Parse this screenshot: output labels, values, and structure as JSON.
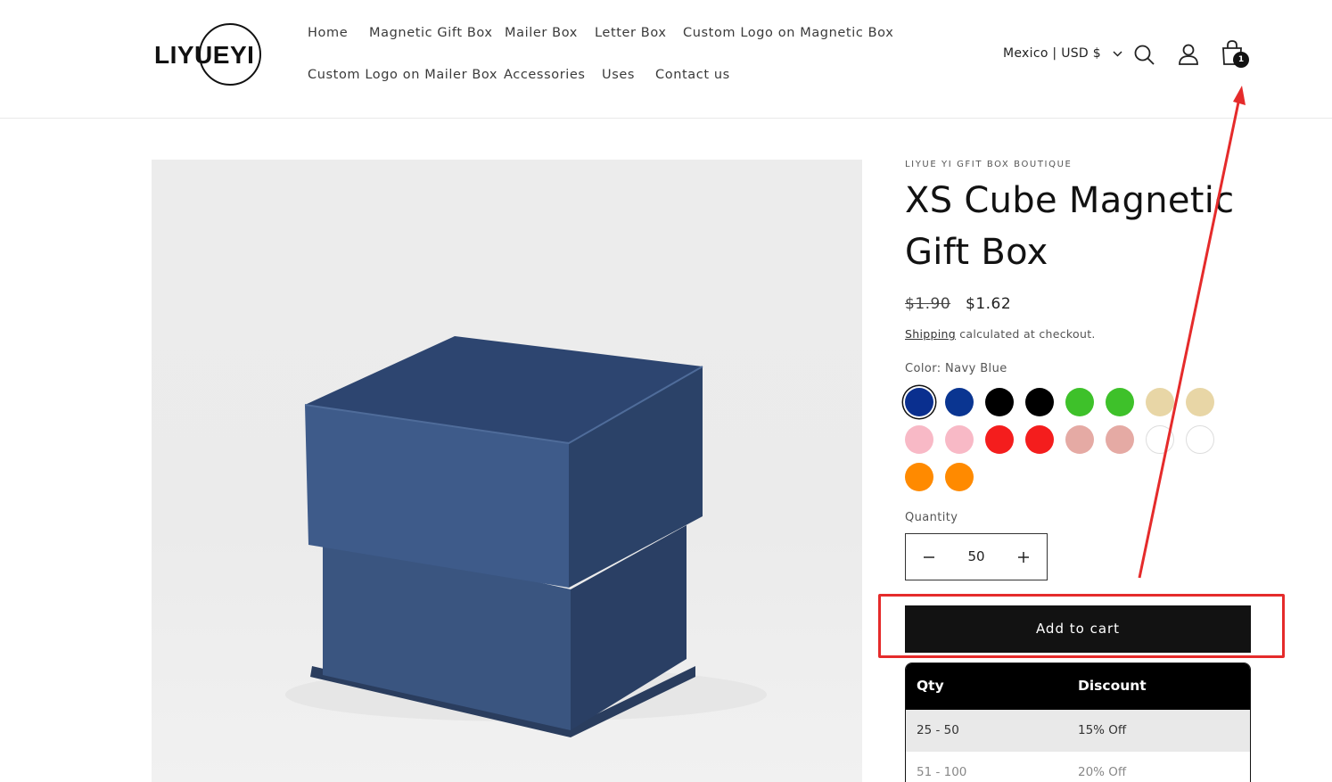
{
  "brand": {
    "logo_text": "LIYUEYI"
  },
  "nav": {
    "row1": [
      "Home",
      "Magnetic Gift Box",
      "Mailer Box",
      "Letter Box",
      "Custom Logo on Magnetic Box"
    ],
    "row2": [
      "Custom Logo on Mailer Box",
      "Accessories",
      "Uses",
      "Contact us"
    ]
  },
  "header": {
    "locale": "Mexico | USD $",
    "cart_count": "1",
    "icons": [
      "search-icon",
      "account-icon",
      "cart-icon"
    ]
  },
  "product": {
    "vendor": "LIYUE YI GFIT BOX BOUTIQUE",
    "title": "XS Cube Magnetic Gift Box",
    "price_original": "$1.90",
    "price_sale": "$1.62",
    "shipping_link": "Shipping",
    "shipping_note": " calculated at checkout.",
    "color_label": "Color: Navy Blue",
    "swatches": [
      "#0a2f8f",
      "#0a3591",
      "#000000",
      "#000000",
      "#3ec12a",
      "#3ec12a",
      "#e8d6a6",
      "#e8d6a6",
      "#f8b9c6",
      "#f8b9c6",
      "#f41d1d",
      "#f41d1d",
      "#e5aaa4",
      "#e5aaa4",
      "#ffffff",
      "#ffffff",
      "#ff8a00",
      "#ff8a00"
    ],
    "quantity_label": "Quantity",
    "quantity": "50",
    "add_to_cart": "Add to cart"
  },
  "discount_table": {
    "headers": [
      "Qty",
      "Discount"
    ],
    "rows": [
      [
        "25 - 50",
        "15% Off"
      ],
      [
        "51 - 100",
        "20% Off"
      ]
    ]
  },
  "annotation_color": "#e52b2b"
}
